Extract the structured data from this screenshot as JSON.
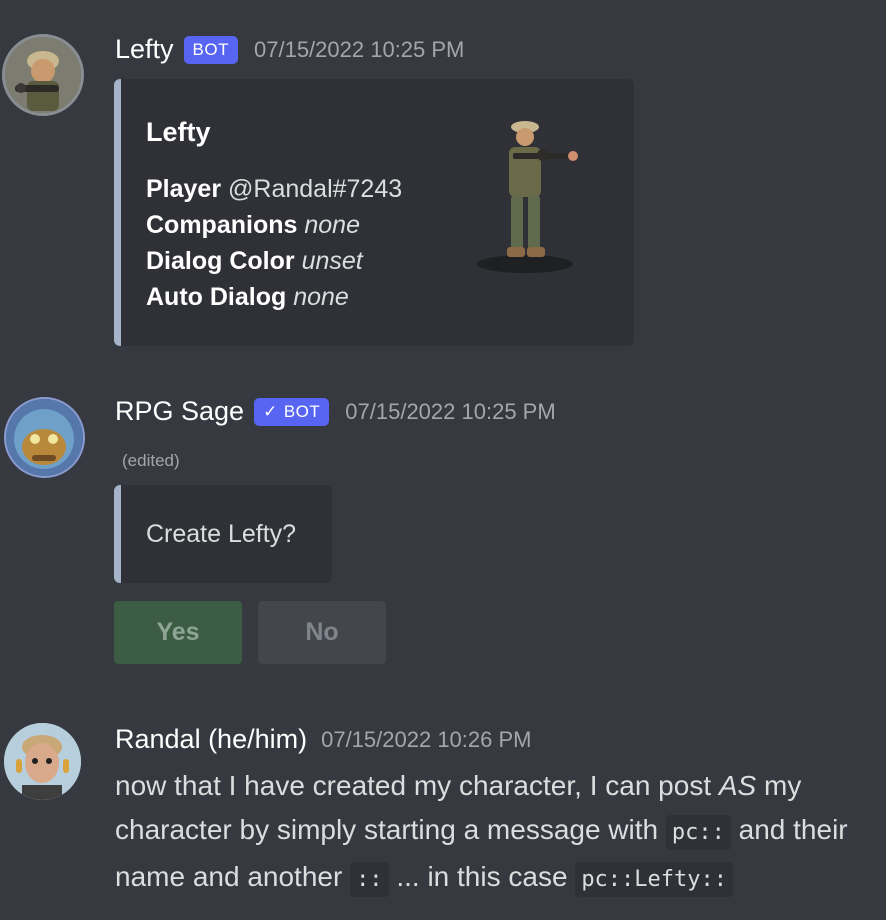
{
  "messages": {
    "m1": {
      "author": "Lefty",
      "badge": "BOT",
      "timestamp": "07/15/2022 10:25 PM",
      "embed": {
        "title": "Lefty",
        "fields": [
          {
            "label": "Player",
            "value": "@Randal#7243",
            "italic": false
          },
          {
            "label": "Companions",
            "value": "none",
            "italic": true
          },
          {
            "label": "Dialog Color",
            "value": "unset",
            "italic": true
          },
          {
            "label": "Auto Dialog",
            "value": "none",
            "italic": true
          }
        ]
      }
    },
    "m2": {
      "author": "RPG Sage",
      "badge_check": "✓",
      "badge": "BOT",
      "timestamp": "07/15/2022 10:25 PM",
      "edited": "(edited)",
      "embed_text": "Create Lefty?",
      "buttons": {
        "yes": "Yes",
        "no": "No"
      }
    },
    "m3": {
      "author": "Randal (he/him)",
      "timestamp": "07/15/2022 10:26 PM",
      "text": {
        "p1": "now that I have created my character, I can post ",
        "emph": "AS",
        "p2": " my character by simply starting a message with ",
        "code1": "pc::",
        "p3": " and their name and another ",
        "code2": "::",
        "p4": " ... in this case ",
        "code3": "pc::Lefty::"
      }
    }
  },
  "colors": {
    "background": "#36393f",
    "embed_bg": "#2f3136",
    "bot_badge": "#5865f2",
    "yes_button": "#3c5c43",
    "no_button": "#43464b"
  }
}
